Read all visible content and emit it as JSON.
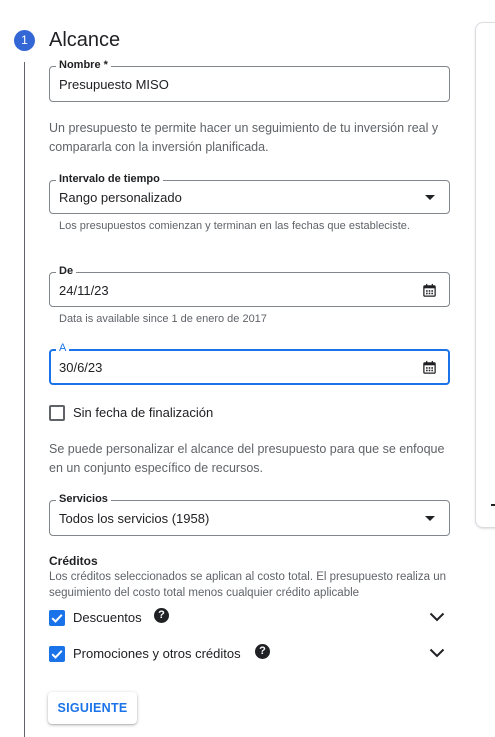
{
  "step": {
    "number": "1",
    "title": "Alcance"
  },
  "name_field": {
    "label": "Nombre *",
    "value": "Presupuesto MISO"
  },
  "intro_text": "Un presupuesto te permite hacer un seguimiento de tu inversión real y compararla con la inversión planificada.",
  "time_range": {
    "label": "Intervalo de tiempo",
    "value": "Rango personalizado",
    "hint": "Los presupuestos comienzan y terminan en las fechas que estableciste."
  },
  "from_field": {
    "label": "De",
    "value": "24/11/23",
    "hint": "Data is available since 1 de enero de 2017"
  },
  "to_field": {
    "label": "A",
    "value": "30/6/23"
  },
  "no_end_date": {
    "label": "Sin fecha de finalización",
    "checked": false
  },
  "scope_text": "Se puede personalizar el alcance del presupuesto para que se enfoque en un conjunto específico de recursos.",
  "services": {
    "label": "Servicios",
    "value": "Todos los servicios (1958)"
  },
  "credits": {
    "title": "Créditos",
    "description": "Los créditos seleccionados se aplican al costo total. El presupuesto realiza un seguimiento del costo total menos cualquier crédito aplicable",
    "items": [
      {
        "label": "Descuentos",
        "checked": true
      },
      {
        "label": "Promociones y otros créditos",
        "checked": true
      }
    ]
  },
  "next_button": "SIGUIENTE",
  "colors": {
    "accent": "#1a73e8",
    "step_circle": "#3367d6",
    "text": "#202124",
    "muted": "#5f6368"
  }
}
